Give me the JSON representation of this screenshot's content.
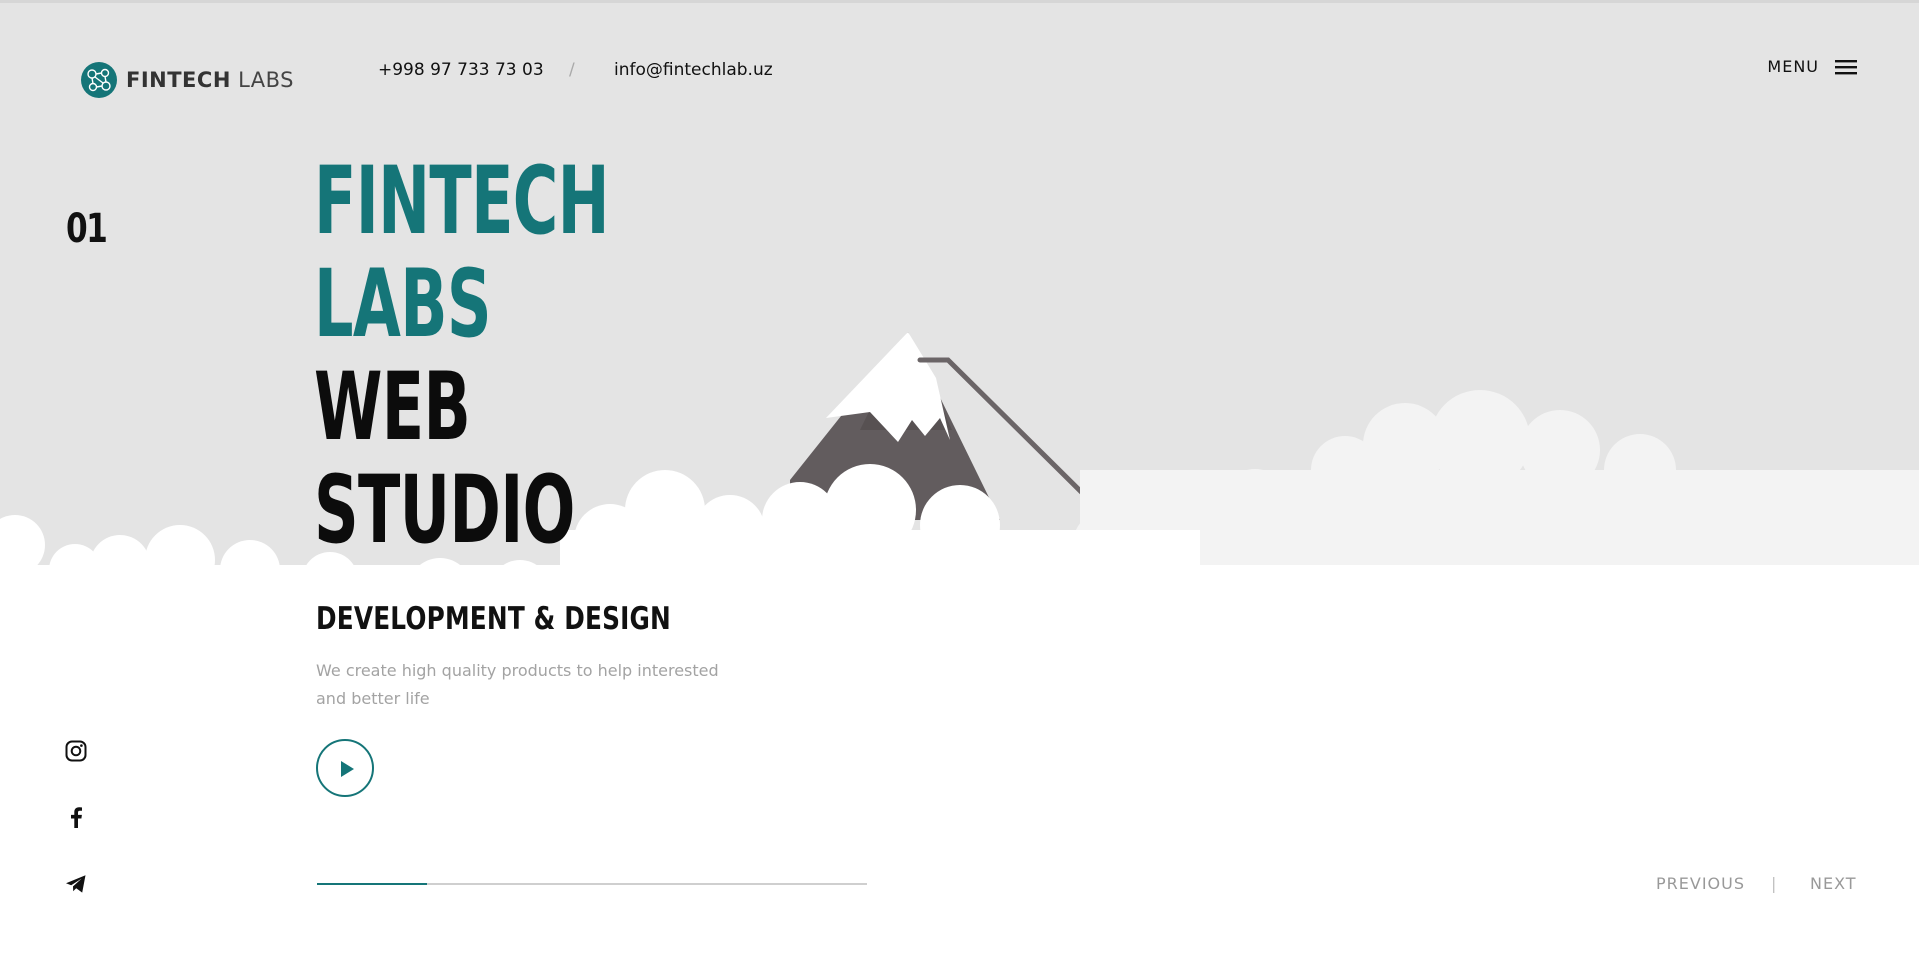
{
  "brand": {
    "logo_bold": "FINTECH",
    "logo_light": "LABS",
    "accent_color": "#157578"
  },
  "header": {
    "phone": "+998 97 733 73 03",
    "separator": "/",
    "email": "info@fintechlab.uz",
    "menu_label": "MENU"
  },
  "slide": {
    "number": "01",
    "headline_teal": [
      "FINTECH",
      "LABS"
    ],
    "headline_dark": [
      "WEB",
      "STUDIO"
    ],
    "subheading": "DEVELOPMENT & DESIGN",
    "description": "We create high quality products to help interested and better life",
    "progress_fraction": 0.2
  },
  "social": {
    "icons": [
      "instagram-icon",
      "facebook-icon",
      "telegram-icon"
    ]
  },
  "navigation": {
    "previous": "PREVIOUS",
    "divider": "|",
    "next": "NEXT"
  }
}
